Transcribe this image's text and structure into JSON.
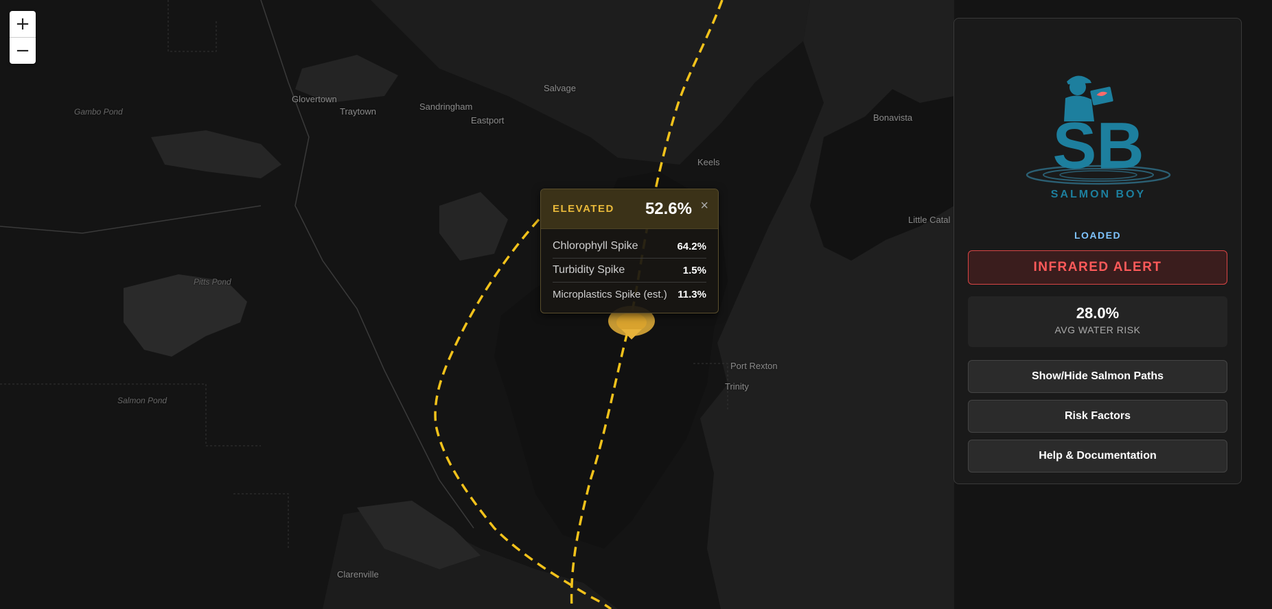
{
  "map": {
    "zoom_in_label": "+",
    "zoom_out_label": "−",
    "labels": [
      {
        "id": "glovertown",
        "text": "Glovertown",
        "kind": "town"
      },
      {
        "id": "traytown",
        "text": "Traytown",
        "kind": "town"
      },
      {
        "id": "sandringham",
        "text": "Sandringham",
        "kind": "town"
      },
      {
        "id": "eastport",
        "text": "Eastport",
        "kind": "town"
      },
      {
        "id": "salvage",
        "text": "Salvage",
        "kind": "town"
      },
      {
        "id": "bonavista",
        "text": "Bonavista",
        "kind": "town"
      },
      {
        "id": "keels",
        "text": "Keels",
        "kind": "town"
      },
      {
        "id": "little-catalina",
        "text": "Little Catal",
        "kind": "town"
      },
      {
        "id": "port-rexton",
        "text": "Port Rexton",
        "kind": "town"
      },
      {
        "id": "trinity",
        "text": "Trinity",
        "kind": "town"
      },
      {
        "id": "clarenville",
        "text": "Clarenville",
        "kind": "town"
      },
      {
        "id": "gambo-pond",
        "text": "Gambo Pond",
        "kind": "water"
      },
      {
        "id": "pitts-pond",
        "text": "Pitts Pond",
        "kind": "water"
      },
      {
        "id": "salmon-pond",
        "text": "Salmon Pond",
        "kind": "water"
      }
    ],
    "path_color": "#f2c21b",
    "hotspot_color": "#e6b23a"
  },
  "popup": {
    "level": "ELEVATED",
    "score": "52.6%",
    "close_glyph": "×",
    "rows": [
      {
        "label": "Chlorophyll Spike",
        "value": "64.2%"
      },
      {
        "label": "Turbidity Spike",
        "value": "1.5%"
      },
      {
        "label": "Microplastics Spike (est.)",
        "value": "11.3%"
      }
    ],
    "level_color": "#e9b93a"
  },
  "panel": {
    "logo_initials": "SB",
    "logo_name": "SALMON BOY",
    "logo_icon": "salmon-boy-logo",
    "status": "LOADED",
    "alert": "INFRARED ALERT",
    "avg_risk_value": "28.0%",
    "avg_risk_label": "AVG WATER RISK",
    "buttons": {
      "paths": "Show/Hide Salmon Paths",
      "risk": "Risk Factors",
      "help": "Help & Documentation"
    },
    "alert_color": "#ff5a5a",
    "status_color": "#7fc4ff",
    "brand_color": "#1d7f9e"
  }
}
